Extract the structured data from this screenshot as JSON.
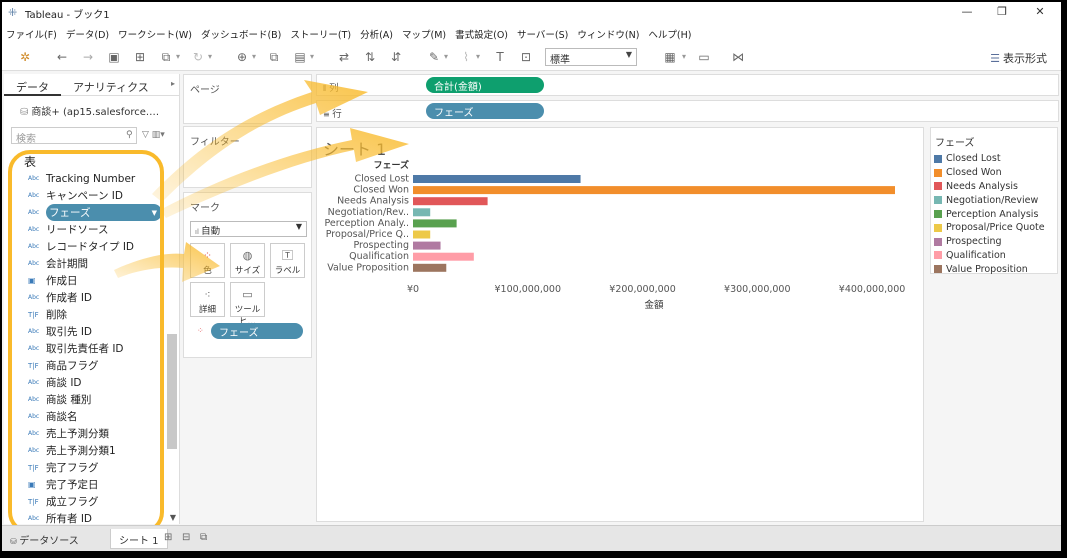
{
  "window": {
    "title": "Tableau - ブック1",
    "minimize": "—",
    "restore": "❐",
    "close": "✕"
  },
  "menu": [
    "ファイル(F)",
    "データ(D)",
    "ワークシート(W)",
    "ダッシュボード(B)",
    "ストーリー(T)",
    "分析(A)",
    "マップ(M)",
    "書式設定(O)",
    "サーバー(S)",
    "ウィンドウ(N)",
    "ヘルプ(H)"
  ],
  "toolbar": {
    "fit_value": "標準",
    "show_me_label": "表示形式"
  },
  "data_pane": {
    "tab_data": "データ",
    "tab_analytics": "アナリティクス",
    "datasource": "商談+ (ap15.salesforce.…",
    "search_placeholder": "検索",
    "section_title": "表",
    "fields": [
      {
        "type": "Abc",
        "name": "Tracking Number"
      },
      {
        "type": "Abc",
        "name": "キャンペーン ID"
      },
      {
        "type": "Abc",
        "name": "フェーズ",
        "selected": true
      },
      {
        "type": "Abc",
        "name": "リードソース"
      },
      {
        "type": "Abc",
        "name": "レコードタイプ ID"
      },
      {
        "type": "Abc",
        "name": "会計期間"
      },
      {
        "type": "date",
        "name": "作成日"
      },
      {
        "type": "Abc",
        "name": "作成者 ID"
      },
      {
        "type": "T|F",
        "name": "削除"
      },
      {
        "type": "Abc",
        "name": "取引先 ID"
      },
      {
        "type": "Abc",
        "name": "取引先責任者 ID"
      },
      {
        "type": "T|F",
        "name": "商品フラグ"
      },
      {
        "type": "Abc",
        "name": "商談 ID"
      },
      {
        "type": "Abc",
        "name": "商談 種別"
      },
      {
        "type": "Abc",
        "name": "商談名"
      },
      {
        "type": "Abc",
        "name": "売上予測分類"
      },
      {
        "type": "Abc",
        "name": "売上予測分類1"
      },
      {
        "type": "T|F",
        "name": "完了フラグ"
      },
      {
        "type": "date",
        "name": "完了予定日"
      },
      {
        "type": "T|F",
        "name": "成立フラグ"
      },
      {
        "type": "Abc",
        "name": "所有者 ID"
      }
    ]
  },
  "pages_label": "ページ",
  "filters_label": "フィルター",
  "marks": {
    "label": "マーク",
    "type": "自動",
    "buttons": [
      "色",
      "サイズ",
      "ラベル",
      "詳細",
      "ツールヒ…"
    ],
    "pill": "フェーズ"
  },
  "shelves": {
    "columns_label": "列",
    "columns_pill": "合計(金額)",
    "rows_label": "行",
    "rows_pill": "フェーズ"
  },
  "sheet_title": "シート 1",
  "chart_data": {
    "type": "bar",
    "orientation": "horizontal",
    "row_header": "フェーズ",
    "categories": [
      "Closed Lost",
      "Closed Won",
      "Needs Analysis",
      "Negotiation/Rev..",
      "Perception Analy..",
      "Proposal/Price Q..",
      "Prospecting",
      "Qualification",
      "Value Proposition"
    ],
    "values": [
      146000000,
      420000000,
      65000000,
      15000000,
      38000000,
      15000000,
      24000000,
      53000000,
      29000000
    ],
    "colors": [
      "#4e79a7",
      "#f28e2b",
      "#e15759",
      "#76b7b2",
      "#59a14f",
      "#edc948",
      "#b07aa1",
      "#ff9da7",
      "#9c755f"
    ],
    "xlabel": "金額",
    "xticks": [
      "¥0",
      "¥100,000,000",
      "¥200,000,000",
      "¥300,000,000",
      "¥400,000,000"
    ],
    "xlim": [
      0,
      420000000
    ],
    "grid": false
  },
  "legend": {
    "title": "フェーズ",
    "items": [
      {
        "name": "Closed Lost",
        "color": "#4e79a7"
      },
      {
        "name": "Closed Won",
        "color": "#f28e2b"
      },
      {
        "name": "Needs Analysis",
        "color": "#e15759"
      },
      {
        "name": "Negotiation/Review",
        "color": "#76b7b2"
      },
      {
        "name": "Perception Analysis",
        "color": "#59a14f"
      },
      {
        "name": "Proposal/Price Quote",
        "color": "#edc948"
      },
      {
        "name": "Prospecting",
        "color": "#b07aa1"
      },
      {
        "name": "Qualification",
        "color": "#ff9da7"
      },
      {
        "name": "Value Proposition",
        "color": "#9c755f"
      }
    ]
  },
  "bottom": {
    "datasource_tab": "データソース",
    "sheet_tab": "シート 1"
  },
  "accent": {
    "highlight": "#f9ba2b",
    "pill_green": "#0e9f6e",
    "pill_blue": "#4b8ead"
  }
}
